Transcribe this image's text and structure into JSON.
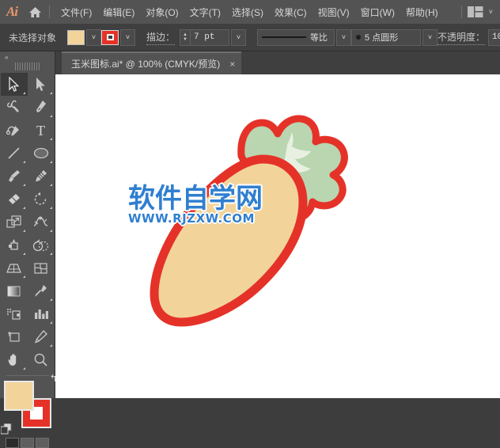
{
  "app": {
    "name": "Ai",
    "logo_label": "Ai",
    "home_icon": "home-icon",
    "workspace_icon": "workspace-switcher-icon",
    "workspace_chevron": "˅"
  },
  "menubar": {
    "items": [
      {
        "label": "文件(F)",
        "name": "menu-file"
      },
      {
        "label": "编辑(E)",
        "name": "menu-edit"
      },
      {
        "label": "对象(O)",
        "name": "menu-object"
      },
      {
        "label": "文字(T)",
        "name": "menu-type"
      },
      {
        "label": "选择(S)",
        "name": "menu-select"
      },
      {
        "label": "效果(C)",
        "name": "menu-effect"
      },
      {
        "label": "视图(V)",
        "name": "menu-view"
      },
      {
        "label": "窗口(W)",
        "name": "menu-window"
      },
      {
        "label": "帮助(H)",
        "name": "menu-help"
      }
    ]
  },
  "controlbar": {
    "selection_status": "未选择对象",
    "fill_color": "#f2d49b",
    "stroke_color": "#e53228",
    "fill_dropdown_chevron": "˅",
    "stroke_dropdown_chevron": "˅",
    "stroke_label": "描边：",
    "stroke_weight": "7 pt",
    "stroke_weight_chevron": "˅",
    "stepper_up": "▲",
    "stepper_down": "▼",
    "profile_label": "等比",
    "profile_chevron": "˅",
    "brush_label": "5 点圆形",
    "brush_chevron": "˅",
    "opacity_label": "不透明度：",
    "opacity_value": "10"
  },
  "tabbar": {
    "document_title": "玉米图标.ai* @ 100% (CMYK/预览)",
    "close_label": "×"
  },
  "toolbar": {
    "collapse_label": "«",
    "tools": [
      {
        "name": "selection-tool",
        "active": true,
        "has_flyout": true
      },
      {
        "name": "direct-selection-tool",
        "active": false,
        "has_flyout": true
      },
      {
        "name": "magic-wand-tool",
        "active": false,
        "has_flyout": false
      },
      {
        "name": "pen-tool",
        "active": false,
        "has_flyout": true
      },
      {
        "name": "curvature-tool",
        "active": false,
        "has_flyout": false
      },
      {
        "name": "type-tool",
        "active": false,
        "has_flyout": true
      },
      {
        "name": "line-segment-tool",
        "active": false,
        "has_flyout": true
      },
      {
        "name": "ellipse-tool",
        "active": false,
        "has_flyout": true
      },
      {
        "name": "paintbrush-tool",
        "active": false,
        "has_flyout": true
      },
      {
        "name": "shaper-pencil-tool",
        "active": false,
        "has_flyout": true
      },
      {
        "name": "eraser-tool",
        "active": false,
        "has_flyout": true
      },
      {
        "name": "rotate-tool",
        "active": false,
        "has_flyout": true
      },
      {
        "name": "scale-tool",
        "active": false,
        "has_flyout": true
      },
      {
        "name": "width-tool",
        "active": false,
        "has_flyout": true
      },
      {
        "name": "free-transform-tool",
        "active": false,
        "has_flyout": false
      },
      {
        "name": "shape-builder-tool",
        "active": false,
        "has_flyout": true
      },
      {
        "name": "perspective-grid-tool",
        "active": false,
        "has_flyout": true
      },
      {
        "name": "mesh-tool",
        "active": false,
        "has_flyout": false
      },
      {
        "name": "gradient-tool",
        "active": false,
        "has_flyout": false
      },
      {
        "name": "eyedropper-tool",
        "active": false,
        "has_flyout": true
      },
      {
        "name": "blend-tool",
        "active": false,
        "has_flyout": false
      },
      {
        "name": "symbol-sprayer-tool",
        "active": false,
        "has_flyout": true
      },
      {
        "name": "column-graph-tool",
        "active": false,
        "has_flyout": true
      },
      {
        "name": "artboard-tool",
        "active": false,
        "has_flyout": false
      },
      {
        "name": "slice-tool",
        "active": false,
        "has_flyout": true
      },
      {
        "name": "hand-tool",
        "active": false,
        "has_flyout": true
      },
      {
        "name": "zoom-tool",
        "active": false,
        "has_flyout": false
      }
    ],
    "fill_color": "#f2d49b",
    "stroke_color": "#e53228",
    "swap_icon": "↰"
  },
  "canvas": {
    "background": "#ffffff",
    "artwork": {
      "name": "carrot-illustration",
      "body_color": "#f2d49b",
      "outline_color": "#e53228",
      "leaf_color": "#b9d6b0",
      "leaf_vein_color": "#e8f0e2"
    },
    "watermark": {
      "main_text": "软件自学网",
      "sub_text": "WWW.RJZXW.COM",
      "color": "#2f7fd0",
      "outline_color": "#ffffff"
    }
  }
}
